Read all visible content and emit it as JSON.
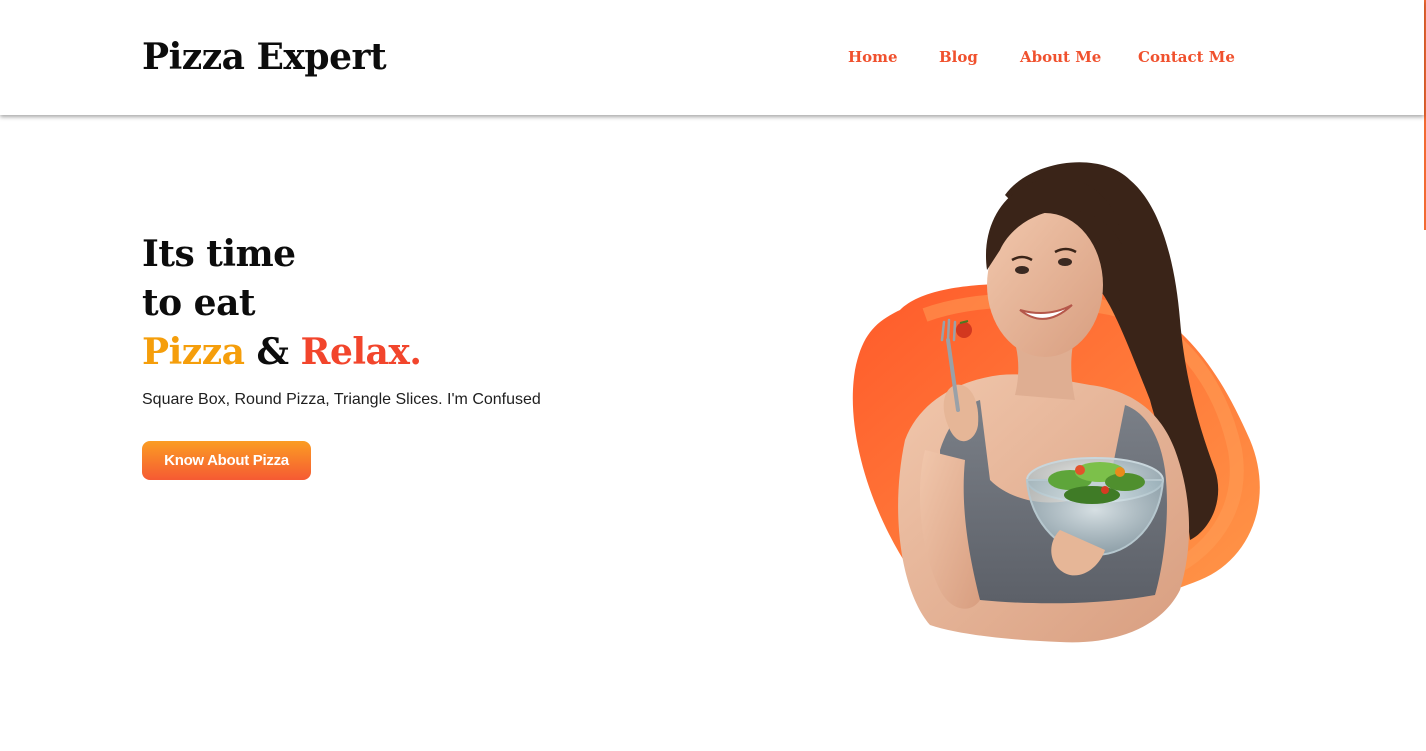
{
  "header": {
    "logo": "Pizza Expert",
    "nav": [
      {
        "label": "Home"
      },
      {
        "label": "Blog"
      },
      {
        "label": "About Me"
      },
      {
        "label": "Contact Me"
      }
    ]
  },
  "hero": {
    "line1": "Its time",
    "line2": "to eat",
    "line3_word1": "Pizza",
    "line3_amp": " & ",
    "line3_word2": "Relax.",
    "subtitle": "Square Box, Round Pizza, Triangle Slices. I'm Confused",
    "cta_label": "Know About Pizza"
  },
  "colors": {
    "nav_link": "#f0512e",
    "accent_yellow": "#f59e0b",
    "accent_red": "#f2452c",
    "cta_gradient_top": "#fb9d23",
    "cta_gradient_bottom": "#f55a33",
    "blob_orange": "#ff7f3a"
  },
  "illustration": {
    "icon": "woman-eating-salad-image"
  }
}
